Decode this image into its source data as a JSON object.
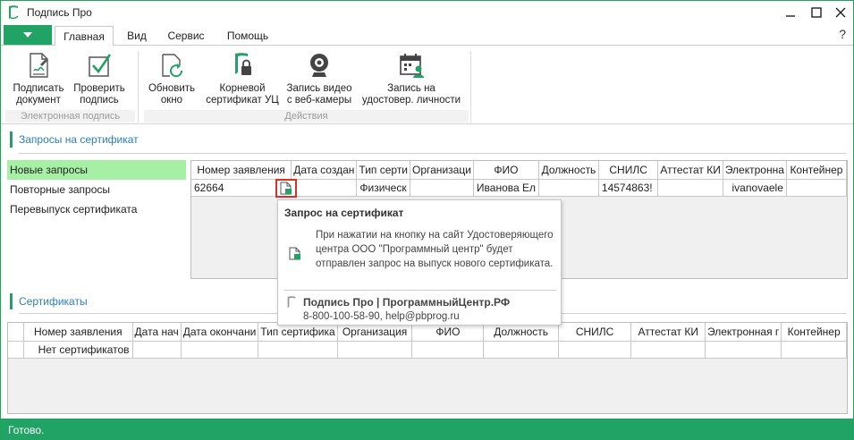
{
  "window": {
    "title": "Подпись Про",
    "minimize_icon": "minimize-icon",
    "maximize_icon": "maximize-icon",
    "close_icon": "close-icon"
  },
  "menu": {
    "file_icon": "dropdown-arrow-icon",
    "tabs": [
      "Главная",
      "Вид",
      "Сервис",
      "Помощь"
    ],
    "active_tab": "Главная",
    "help": "?"
  },
  "ribbon": {
    "groups": [
      {
        "label": "Электронная подпись",
        "buttons": [
          {
            "line1": "Подписать",
            "line2": "документ",
            "icon": "sign-document-icon"
          },
          {
            "line1": "Проверить",
            "line2": "подпись",
            "icon": "verify-signature-icon"
          }
        ]
      },
      {
        "label": "Действия",
        "buttons": [
          {
            "line1": "Обновить",
            "line2": "окно",
            "icon": "refresh-window-icon"
          },
          {
            "line1": "Корневой",
            "line2": "сертификат УЦ",
            "icon": "root-certificate-icon"
          },
          {
            "line1": "Запись видео",
            "line2": "с веб-камеры",
            "icon": "webcam-icon"
          },
          {
            "line1": "Запись на",
            "line2": "удостовер. личности",
            "icon": "identity-appointment-icon"
          }
        ]
      }
    ]
  },
  "requests": {
    "section_title": "Запросы на сертификат",
    "left_items": [
      "Новые запросы",
      "Повторные запросы",
      "Перевыпуск сертификата"
    ],
    "selected_index": 0,
    "columns": [
      "Номер заявления",
      "Дата создан",
      "Тип серти",
      "Организаци",
      "ФИО",
      "Должность",
      "СНИЛС",
      "Аттестат КИ",
      "Электронна",
      "Контейнер"
    ],
    "rows": [
      {
        "cells": [
          "62664",
          "",
          "Физическ",
          "",
          "Иванова Ел",
          "",
          "14574863!",
          "",
          "ivanovaele",
          ""
        ]
      }
    ]
  },
  "tooltip": {
    "title": "Запрос на сертификат",
    "body": "При нажатии на кнопку на сайт Удостоверяющего центра ООО \"Программный центр\" будет отправлен запрос на выпуск нового сертификата.",
    "brand": "Подпись Про | ПрограммныйЦентр.РФ",
    "contacts": "8-800-100-58-90, help@pbprog.ru"
  },
  "certificates": {
    "section_title": "Сертификаты",
    "columns": [
      "Номер заявления",
      "Дата нач",
      "Дата окончани",
      "Тип сертифика",
      "Организация",
      "ФИО",
      "Должность",
      "СНИЛС",
      "Аттестат КИ",
      "Электронная г",
      "Контейнер"
    ],
    "empty_text": "Нет сертификатов"
  },
  "status": {
    "text": "Готово."
  },
  "colors": {
    "accent": "#21a366",
    "selection": "#a6f0a6",
    "highlight_border": "#d9302a",
    "section_title": "#2a7fbf"
  }
}
